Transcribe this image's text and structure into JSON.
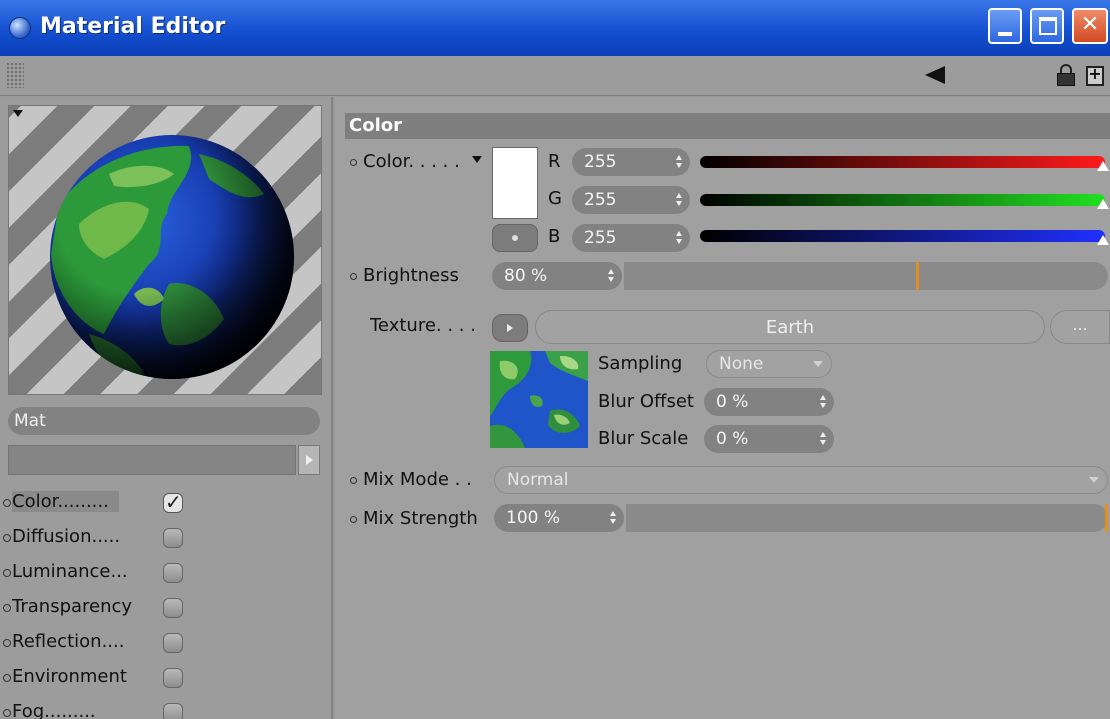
{
  "window": {
    "title": "Material Editor"
  },
  "left": {
    "material_name": "Mat",
    "channels": [
      {
        "label": "Color",
        "dots": ".........",
        "enabled": true
      },
      {
        "label": "Diffusion",
        "dots": ".....",
        "enabled": false
      },
      {
        "label": "Luminance",
        "dots": "...",
        "enabled": false
      },
      {
        "label": "Transparency",
        "dots": "",
        "enabled": false
      },
      {
        "label": "Reflection",
        "dots": "....",
        "enabled": false
      },
      {
        "label": "Environment",
        "dots": "",
        "enabled": false
      },
      {
        "label": "Fog",
        "dots": ".........",
        "enabled": false
      }
    ]
  },
  "section": {
    "title": "Color"
  },
  "color": {
    "label": "Color. . . . .",
    "swatch_hex": "#ffffff",
    "r_label": "R",
    "r_value": "255",
    "g_label": "G",
    "g_value": "255",
    "b_label": "B",
    "b_value": "255"
  },
  "brightness": {
    "label": "Brightness",
    "value": "80 %",
    "fraction": 0.8
  },
  "texture": {
    "label": "Texture. . . .",
    "name": "Earth",
    "more_label": "...",
    "sampling_label": "Sampling",
    "sampling_value": "None",
    "blur_offset_label": "Blur Offset",
    "blur_offset_value": "0 %",
    "blur_scale_label": "Blur Scale",
    "blur_scale_value": "0 %"
  },
  "mix_mode": {
    "label": "Mix Mode . .",
    "value": "Normal"
  },
  "mix_strength": {
    "label": "Mix Strength",
    "value": "100 %",
    "fraction": 1.0
  },
  "colors": {
    "titlebar": "#1450d0",
    "slider_marker": "#e09020"
  },
  "icons": {
    "app": "sphere-icon",
    "back": "arrow-left-icon",
    "lock": "lock-icon",
    "new_window": "new-window-icon"
  }
}
